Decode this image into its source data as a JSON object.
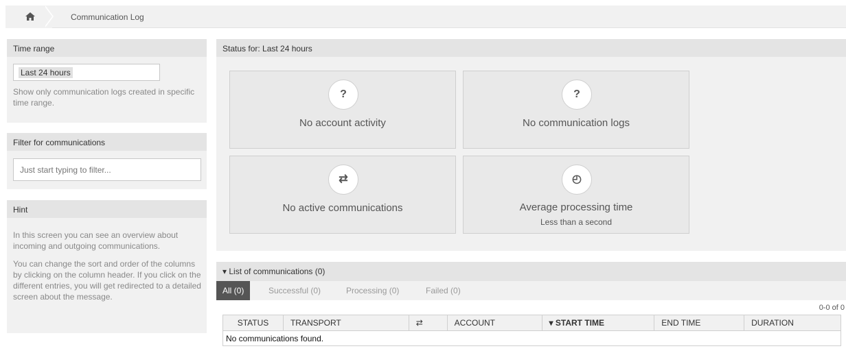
{
  "breadcrumb": {
    "home_icon": "home-icon",
    "current": "Communication Log"
  },
  "sidebar": {
    "time_range": {
      "title": "Time range",
      "selected": "Last 24 hours",
      "description": "Show only communication logs created in specific time range."
    },
    "filter": {
      "title": "Filter for communications",
      "placeholder": "Just start typing to filter..."
    },
    "hint": {
      "title": "Hint",
      "paragraph1": "In this screen you can see an overview about incoming and outgoing communications.",
      "paragraph2": "You can change the sort and order of the columns by clicking on the column header. If you click on the different entries, you will get redirected to a detailed screen about the message."
    }
  },
  "status": {
    "title": "Status for: Last 24 hours",
    "tiles": [
      {
        "icon": "question-icon",
        "glyph": "?",
        "label": "No account activity"
      },
      {
        "icon": "question-icon",
        "glyph": "?",
        "label": "No communication logs"
      },
      {
        "icon": "exchange-icon",
        "glyph": "⇄",
        "label": "No active communications"
      },
      {
        "icon": "clock-icon",
        "glyph": "◴",
        "label": "Average processing time",
        "sub": "Less than a second"
      }
    ]
  },
  "list": {
    "title": "List of communications (0)",
    "tabs": {
      "all": "All (0)",
      "successful": "Successful (0)",
      "processing": "Processing (0)",
      "failed": "Failed (0)"
    },
    "pager": "0-0 of 0",
    "columns": {
      "status": "STATUS",
      "transport": "TRANSPORT",
      "direction": "⇄",
      "account": "ACCOUNT",
      "start_time": "▾ START TIME",
      "end_time": "END TIME",
      "duration": "DURATION"
    },
    "empty_message": "No communications found."
  }
}
